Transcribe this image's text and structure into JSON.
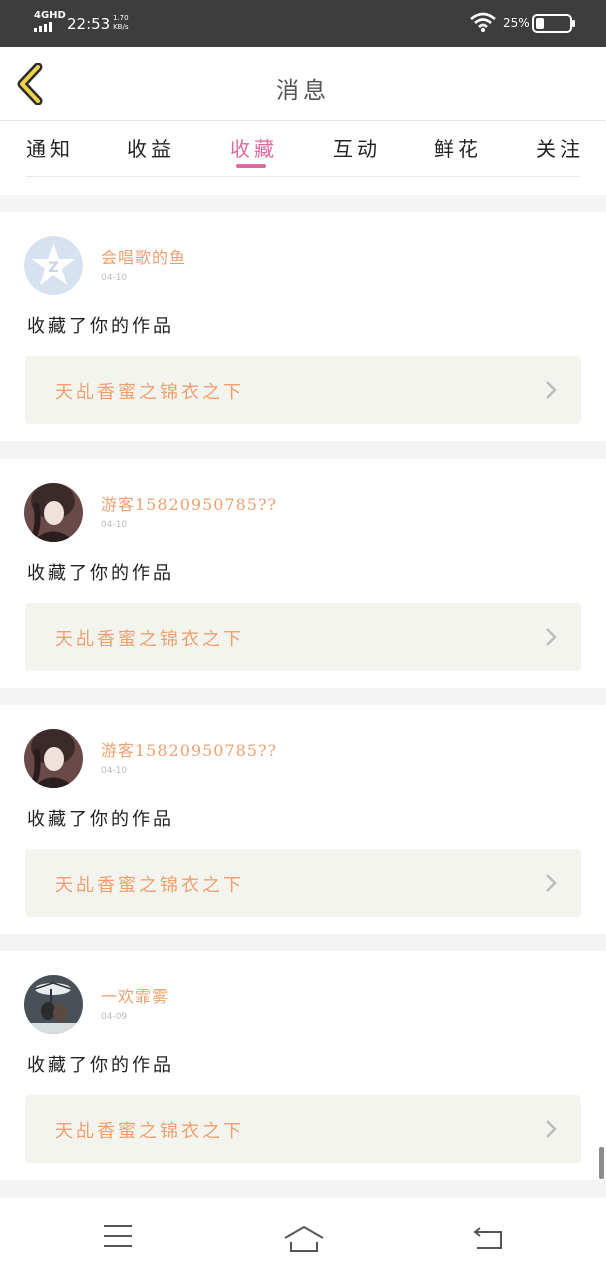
{
  "status_bar": {
    "network": "4GHD",
    "time": "22:53",
    "speed_value": "1.70",
    "speed_unit": "KB/s",
    "battery": "25%",
    "battery_level": 0.25
  },
  "header": {
    "title": "消息",
    "back_icon": "chevron-left-icon"
  },
  "tabs": [
    {
      "label": "通知",
      "active": false
    },
    {
      "label": "收益",
      "active": false
    },
    {
      "label": "收藏",
      "active": true
    },
    {
      "label": "互动",
      "active": false
    },
    {
      "label": "鲜花",
      "active": false
    },
    {
      "label": "关注",
      "active": false
    }
  ],
  "feed": [
    {
      "user": "会唱歌的鱼",
      "date": "04-10",
      "action": "收藏了你的作品",
      "work": "天乩香蜜之锦衣之下",
      "avatar": "default-avatar"
    },
    {
      "user": "游客15820950785??",
      "date": "04-10",
      "action": "收藏了你的作品",
      "work": "天乩香蜜之锦衣之下",
      "avatar": "user-photo"
    },
    {
      "user": "游客15820950785??",
      "date": "04-10",
      "action": "收藏了你的作品",
      "work": "天乩香蜜之锦衣之下",
      "avatar": "user-photo"
    },
    {
      "user": "一欢霏雾",
      "date": "04-09",
      "action": "收藏了你的作品",
      "work": "天乩香蜜之锦衣之下",
      "avatar": "user-photo-snow"
    }
  ],
  "colors": {
    "accent": "#e06aa0",
    "username": "#f0a070",
    "status_bar": "#3d3d3d",
    "card_inner": "#f4f4ee"
  },
  "navbar": {
    "menu_icon": "menu-icon",
    "home_icon": "home-icon",
    "back_icon": "return-icon"
  }
}
